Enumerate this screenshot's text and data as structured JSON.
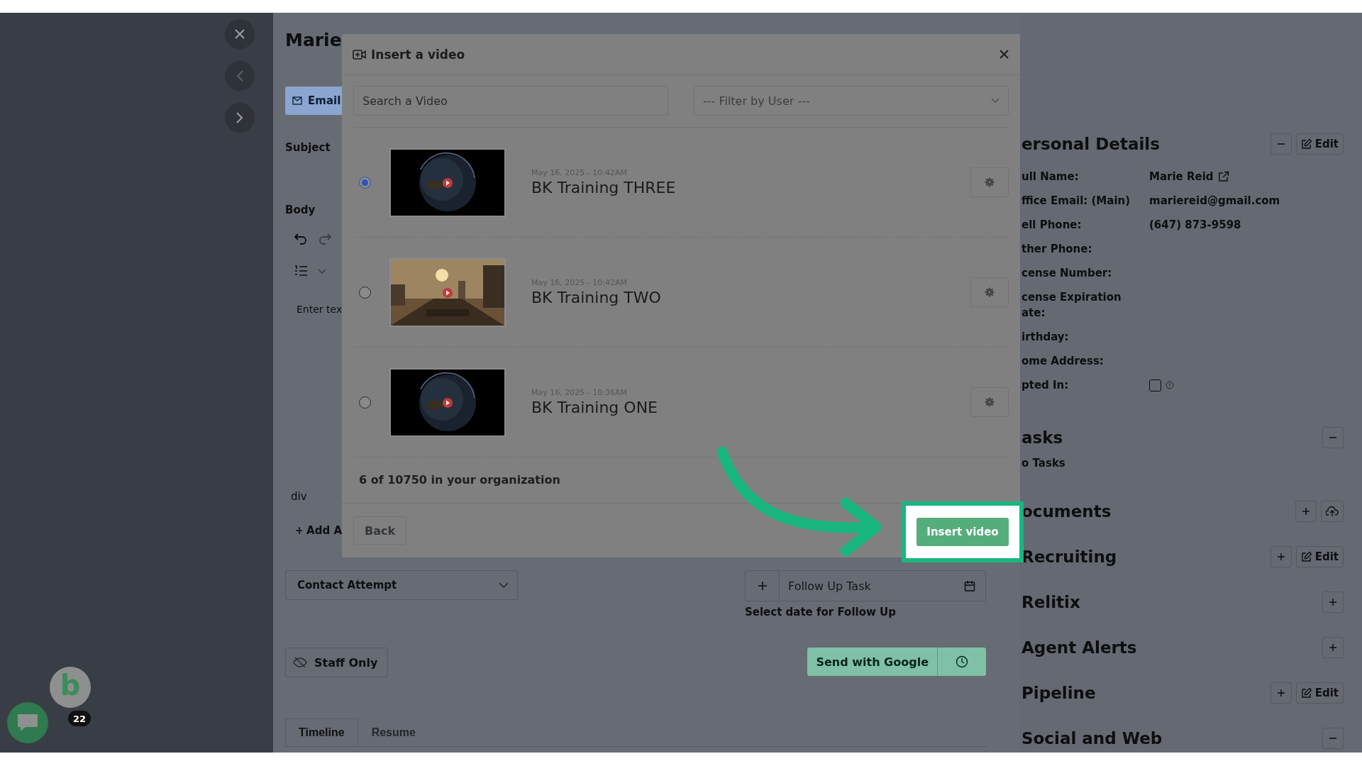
{
  "background": {
    "title": "Marie",
    "email_tab": "Email",
    "subject_label": "Subject",
    "body_label": "Body",
    "editor_placeholder": "Enter tex",
    "path_label": "div",
    "add_link": "Add A",
    "contact_attempt": "Contact Attempt",
    "follow_up": {
      "placeholder": "Follow Up Task"
    },
    "follow_up_hint": "Select date for Follow Up",
    "staff_only": "Staff Only",
    "send_button": "Send with Google",
    "tabs": [
      {
        "label": "Timeline",
        "selected": true
      },
      {
        "label": "Resume",
        "selected": false
      }
    ]
  },
  "personal_details": {
    "title": "ersonal Details",
    "edit": "Edit",
    "fields": [
      {
        "label": "ull Name:",
        "value": "Marie Reid"
      },
      {
        "label": "ffice Email: (Main)",
        "value": "mariereid@gmail.com"
      },
      {
        "label": "ell Phone:",
        "value": "(647) 873-9598"
      },
      {
        "label": "ther Phone:"
      },
      {
        "label": "cense Number:"
      },
      {
        "label": "cense Expiration",
        "label_cont": "ate:"
      },
      {
        "label": "irthday:"
      },
      {
        "label": "ome Address:"
      }
    ],
    "opted_in": {
      "label": "pted In:",
      "checked": false
    }
  },
  "sections": [
    {
      "title": "asks",
      "body": "o Tasks",
      "buttons": [
        {
          "kind": "minus"
        }
      ]
    },
    {
      "title": "ocuments",
      "buttons": [
        {
          "kind": "plus"
        },
        {
          "kind": "upload"
        }
      ]
    },
    {
      "title": "Recruiting",
      "buttons": [
        {
          "kind": "plus"
        },
        {
          "kind": "edit",
          "label": "Edit"
        }
      ]
    },
    {
      "title": "Relitix",
      "buttons": [
        {
          "kind": "plus"
        }
      ]
    },
    {
      "title": "Agent Alerts",
      "buttons": [
        {
          "kind": "plus"
        }
      ]
    },
    {
      "title": "Pipeline",
      "buttons": [
        {
          "kind": "plus"
        },
        {
          "kind": "edit",
          "label": "Edit"
        }
      ]
    },
    {
      "title": "Social and Web",
      "buttons": [
        {
          "kind": "minus"
        }
      ]
    }
  ],
  "modal": {
    "title": "Insert a video",
    "search": {
      "placeholder": "Search a Video"
    },
    "filter": {
      "placeholder": "--- Filter by User ---"
    },
    "videos": [
      {
        "date": "May 16, 2025 - 10:42AM",
        "title": "BK Training THREE",
        "selected": true
      },
      {
        "date": "May 16, 2025 - 10:42AM",
        "title": "BK Training TWO",
        "selected": false
      },
      {
        "date": "May 16, 2025 - 10:36AM",
        "title": "BK Training ONE",
        "selected": false
      }
    ],
    "count": "6 of 10750 in your organization",
    "back": "Back",
    "insert": "Insert video"
  },
  "chat_widget": {
    "logo": "b",
    "badge": "22"
  }
}
